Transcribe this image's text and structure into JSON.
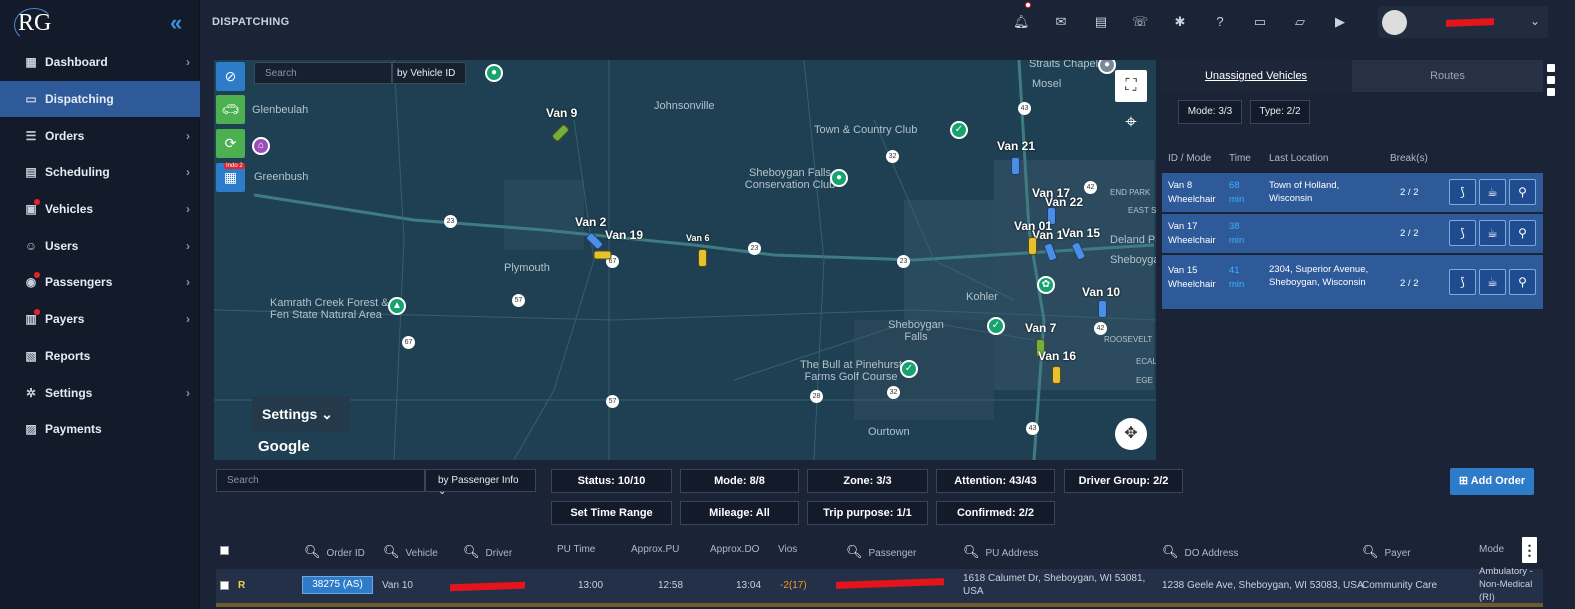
{
  "app": {
    "logo": "RG",
    "page_title": "DISPATCHING"
  },
  "sidebar": {
    "items": [
      {
        "label": "Dashboard",
        "icon": "chart-icon",
        "chevron": true,
        "dot": false
      },
      {
        "label": "Dispatching",
        "icon": "monitor-icon",
        "chevron": false,
        "dot": false,
        "active": true
      },
      {
        "label": "Orders",
        "icon": "orders-icon",
        "chevron": true,
        "dot": false
      },
      {
        "label": "Scheduling",
        "icon": "calendar-icon",
        "chevron": true,
        "dot": false
      },
      {
        "label": "Vehicles",
        "icon": "bus-icon",
        "chevron": true,
        "dot": true
      },
      {
        "label": "Users",
        "icon": "users-icon",
        "chevron": true,
        "dot": false
      },
      {
        "label": "Passengers",
        "icon": "location-icon",
        "chevron": true,
        "dot": true
      },
      {
        "label": "Payers",
        "icon": "briefcase-icon",
        "chevron": true,
        "dot": true
      },
      {
        "label": "Reports",
        "icon": "report-icon",
        "chevron": false,
        "dot": false
      },
      {
        "label": "Settings",
        "icon": "gear-icon",
        "chevron": true,
        "dot": false
      },
      {
        "label": "Payments",
        "icon": "payment-icon",
        "chevron": false,
        "dot": false
      }
    ]
  },
  "map": {
    "search_placeholder": "Search",
    "search_mode": "by Vehicle ID",
    "settings_label": "Settings",
    "attribution": "Google",
    "indo_badge": "Indo 2",
    "places": [
      "Glenbeulah",
      "Johnsonville",
      "Greenbush",
      "Plymouth",
      "Town & Country Club",
      "Sheboygan Falls Conservation Club",
      "Mosel",
      "Straits Chapel",
      "Kohler",
      "Sheboygan Falls",
      "The Bull at Pinehurst Farms Golf Course",
      "Ourtown",
      "Kamrath Creek Forest & Fen State Natural Area",
      "Sheboyga",
      "END PARK",
      "EAST S",
      "Deland Park",
      "ROOSEVELT",
      "ECAL",
      "EGE"
    ],
    "highways": [
      "23",
      "23",
      "23",
      "32",
      "32",
      "42",
      "57",
      "57",
      "67",
      "67",
      "28",
      "43",
      "43",
      "42"
    ],
    "vans": [
      "Van 9",
      "Van 2",
      "Van 19",
      "Van 21",
      "Van 17",
      "Van 22",
      "Van 01",
      "Van 1",
      "Van 15",
      "Van 10",
      "Van 7",
      "Van 16",
      "Van 6"
    ]
  },
  "panel": {
    "tabs": [
      "Unassigned Vehicles",
      "Routes"
    ],
    "mode_filter": "Mode: 3/3",
    "type_filter": "Type: 2/2",
    "columns": [
      "ID / Mode",
      "Time",
      "Last Location",
      "Break(s)"
    ],
    "rows": [
      {
        "id": "Van 8",
        "mode": "Wheelchair",
        "time": "68",
        "unit": "min",
        "location": "Town of Holland, Wisconsin",
        "breaks": "2 / 2"
      },
      {
        "id": "Van 17",
        "mode": "Wheelchair",
        "time": "38",
        "unit": "min",
        "location": "",
        "breaks": "2 / 2"
      },
      {
        "id": "Van 15",
        "mode": "Wheelchair",
        "time": "41",
        "unit": "min",
        "location": "2304, Superior Avenue, Sheboygan, Wisconsin",
        "breaks": "2 / 2"
      }
    ]
  },
  "orders": {
    "search_placeholder": "Search",
    "search_mode": "by Passenger Info",
    "filters_row1": [
      "Status: 10/10",
      "Mode: 8/8",
      "Zone: 3/3",
      "Attention: 43/43",
      "Driver Group: 2/2"
    ],
    "filters_row2": [
      "Set Time Range",
      "Mileage: All",
      "Trip purpose: 1/1",
      "Confirmed: 2/2"
    ],
    "add_order": "Add Order",
    "columns": [
      "Order ID",
      "Vehicle",
      "Driver",
      "PU Time",
      "Approx.PU",
      "Approx.DO",
      "Vios",
      "Passenger",
      "PU Address",
      "DO Address",
      "Payer",
      "Mode"
    ],
    "rows": [
      {
        "flag": "R",
        "order_id": "38275 (AS)",
        "vehicle": "Van 10",
        "pu_time": "13:00",
        "approx_pu": "12:58",
        "approx_do": "13:04",
        "vios": "-2(17)",
        "pu_address": "1618 Calumet Dr, Sheboygan, WI 53081, USA",
        "do_address": "1238 Geele Ave, Sheboygan, WI 53083, USA",
        "payer": "Community Care",
        "mode": "Ambulatory - Non-Medical (RI)"
      }
    ]
  },
  "colors": {
    "accent": "#2e5a9a",
    "button": "#2e7cc9",
    "map_bg": "#1f4052",
    "sidebar": "#131b2b"
  }
}
